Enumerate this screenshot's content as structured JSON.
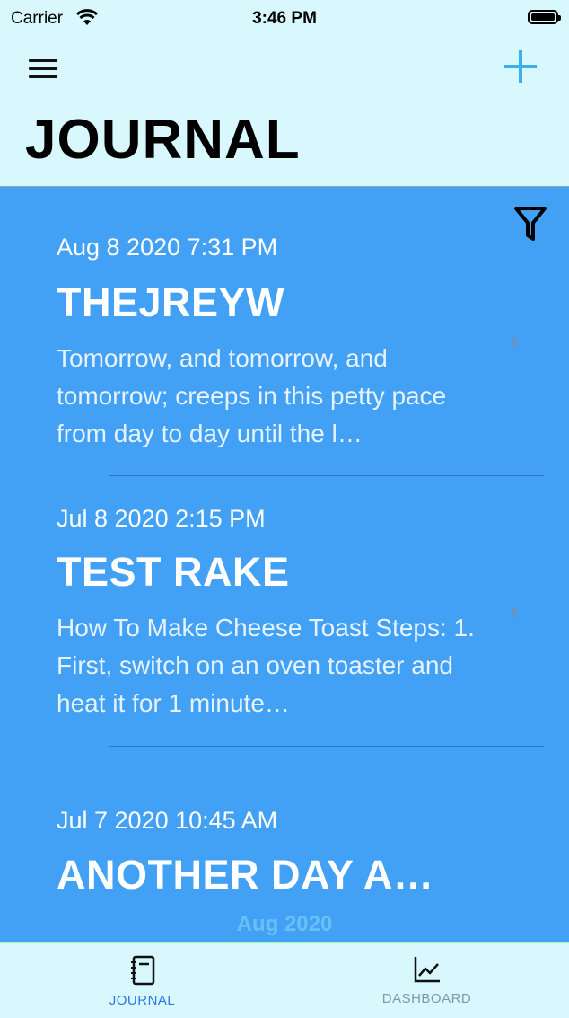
{
  "status_bar": {
    "carrier": "Carrier",
    "time": "3:46 PM"
  },
  "header": {
    "title": "JOURNAL"
  },
  "entries": [
    {
      "date": "Aug 8 2020 7:31 PM",
      "title": "THEJREYW",
      "preview": "Tomorrow, and tomorrow, and tomorrow; creeps in this petty pace from day to day until the l…"
    },
    {
      "date": "Jul 8 2020 2:15 PM",
      "title": "TEST RAKE",
      "preview": "How To Make Cheese Toast Steps: 1. First, switch on an oven toaster and heat it for 1 minute…"
    },
    {
      "date": "Jul 7 2020 10:45 AM",
      "title": "ANOTHER DAY A…",
      "preview": ""
    }
  ],
  "section_footer": "Aug 2020",
  "tabs": [
    {
      "label": "JOURNAL",
      "icon": "notebook-icon",
      "active": true
    },
    {
      "label": "DASHBOARD",
      "icon": "chart-icon",
      "active": false
    }
  ],
  "colors": {
    "header_bg": "#d8f8fd",
    "list_bg": "#42a0f5",
    "accent": "#3ab0ef",
    "tab_active": "#2b79e5",
    "tab_inactive": "#7f9aa6"
  }
}
